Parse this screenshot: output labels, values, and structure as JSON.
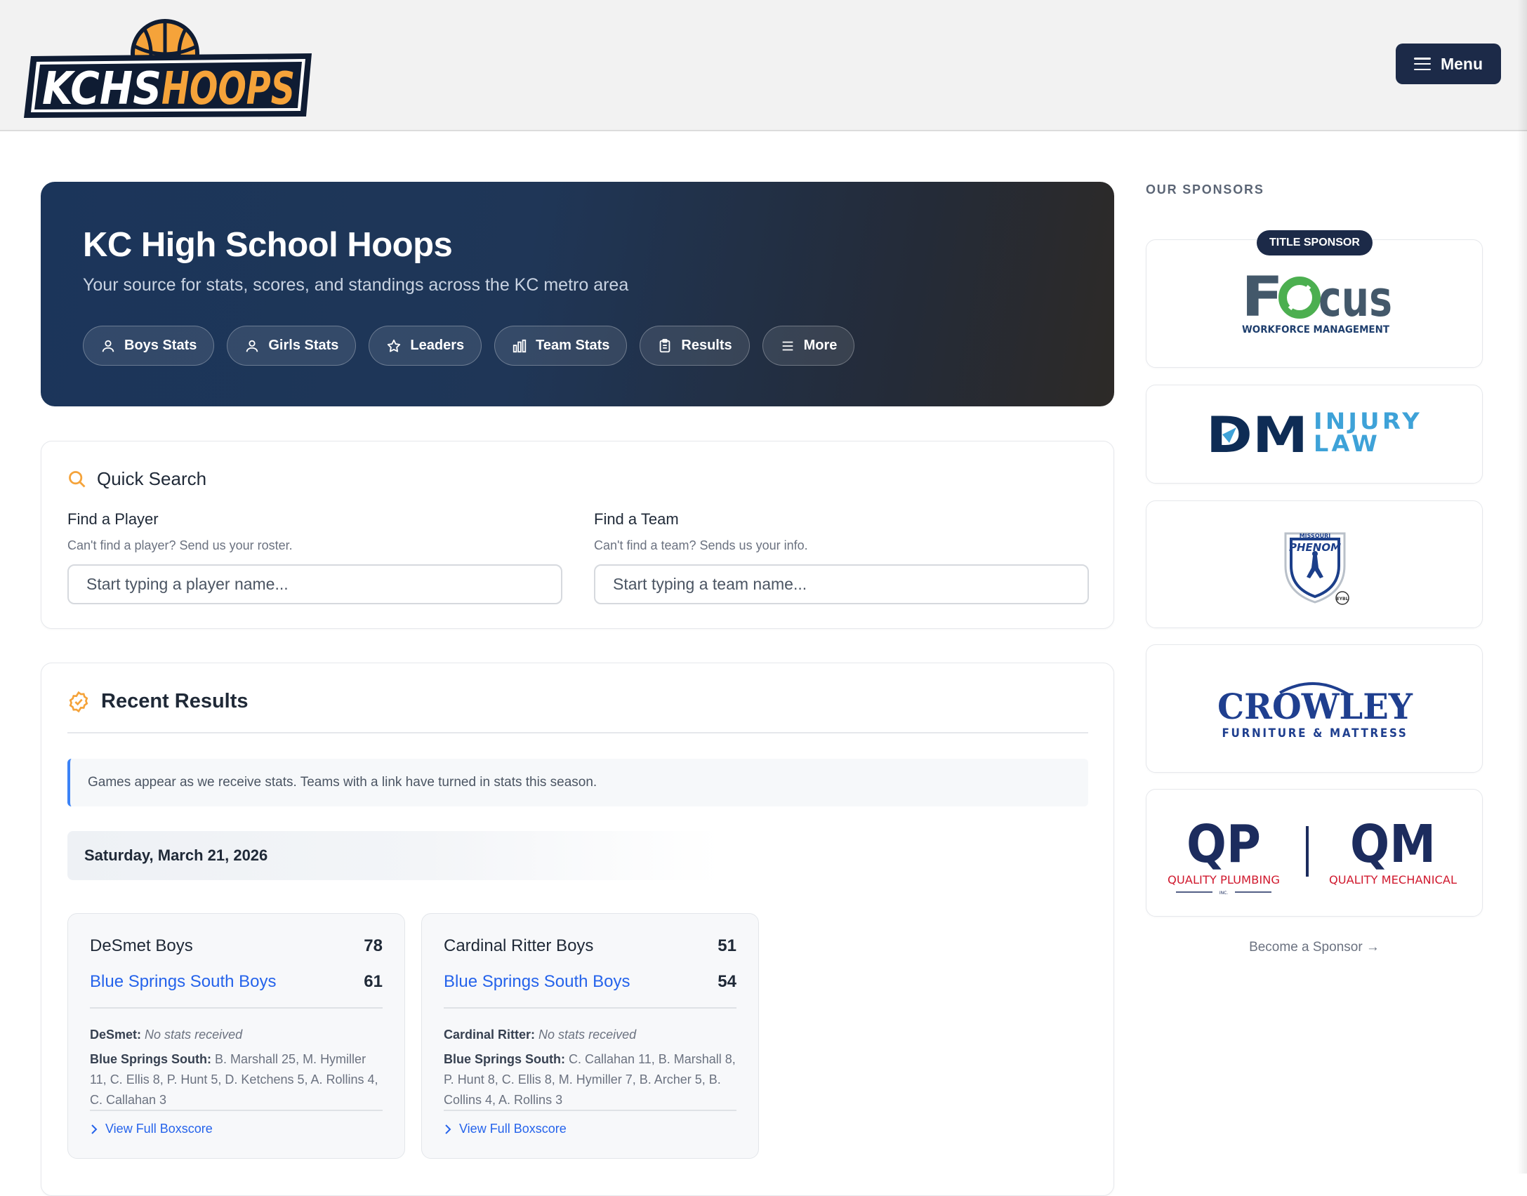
{
  "header": {
    "logo_text_left": "KCHS",
    "logo_text_right": "HOOPS",
    "menu_label": "Menu"
  },
  "hero": {
    "title": "KC High School Hoops",
    "subtitle": "Your source for stats, scores, and standings across the KC metro area",
    "nav": [
      {
        "label": "Boys Stats",
        "icon": "user-icon"
      },
      {
        "label": "Girls Stats",
        "icon": "user-icon"
      },
      {
        "label": "Leaders",
        "icon": "star-icon"
      },
      {
        "label": "Team Stats",
        "icon": "bar-chart-icon"
      },
      {
        "label": "Results",
        "icon": "clipboard-icon"
      },
      {
        "label": "More",
        "icon": "menu-icon"
      }
    ]
  },
  "quick_search": {
    "title": "Quick Search",
    "player": {
      "label": "Find a Player",
      "hint": "Can't find a player? Send us your roster.",
      "placeholder": "Start typing a player name..."
    },
    "team": {
      "label": "Find a Team",
      "hint": "Can't find a team? Sends us your info.",
      "placeholder": "Start typing a team name..."
    }
  },
  "recent_results": {
    "title": "Recent Results",
    "notice": "Games appear as we receive stats. Teams with a link have turned in stats this season.",
    "date": "Saturday, March 21, 2026",
    "games": [
      {
        "home": "DeSmet Boys",
        "home_score": "78",
        "away": "Blue Springs South Boys",
        "away_score": "61",
        "home_short": "DeSmet:",
        "home_stats": "No stats received",
        "away_short": "Blue Springs South:",
        "away_stats": "B. Marshall 25, M. Hymiller 11, C. Ellis 8, P. Hunt 5, D. Ketchens 5, A. Rollins 4, C. Callahan 3",
        "boxscore": "View Full Boxscore"
      },
      {
        "home": "Cardinal Ritter Boys",
        "home_score": "51",
        "away": "Blue Springs South Boys",
        "away_score": "54",
        "home_short": "Cardinal Ritter:",
        "home_stats": "No stats received",
        "away_short": "Blue Springs South:",
        "away_stats": "C. Callahan 11, B. Marshall 8, P. Hunt 8, C. Ellis 8, M. Hymiller 7, B. Archer 5, B. Collins 4, A. Rollins 3",
        "boxscore": "View Full Boxscore"
      }
    ]
  },
  "sponsors": {
    "heading": "OUR SPONSORS",
    "title_badge": "TITLE SPONSOR",
    "focus": {
      "name": "Focus",
      "tagline": "WORKFORCE MANAGEMENT"
    },
    "dm": {
      "mark": "DM",
      "line1": "INJURY",
      "line2": "LAW"
    },
    "phenom": {
      "top": "MISSOURI",
      "name": "PHENOM",
      "tag": "EYBL"
    },
    "crowley": {
      "name": "CROWLEY",
      "tagline": "FURNITURE & MATTRESS"
    },
    "qpqm": {
      "qp": "QP",
      "qp_name": "QUALITY PLUMBING",
      "qp_inc": "INC.",
      "qm": "QM",
      "qm_name": "QUALITY MECHANICAL"
    },
    "become": "Become a Sponsor →"
  },
  "colors": {
    "navy": "#1c2a48",
    "accent_orange": "#f5a33a",
    "link_blue": "#2563eb",
    "qp_red": "#d0192e"
  }
}
